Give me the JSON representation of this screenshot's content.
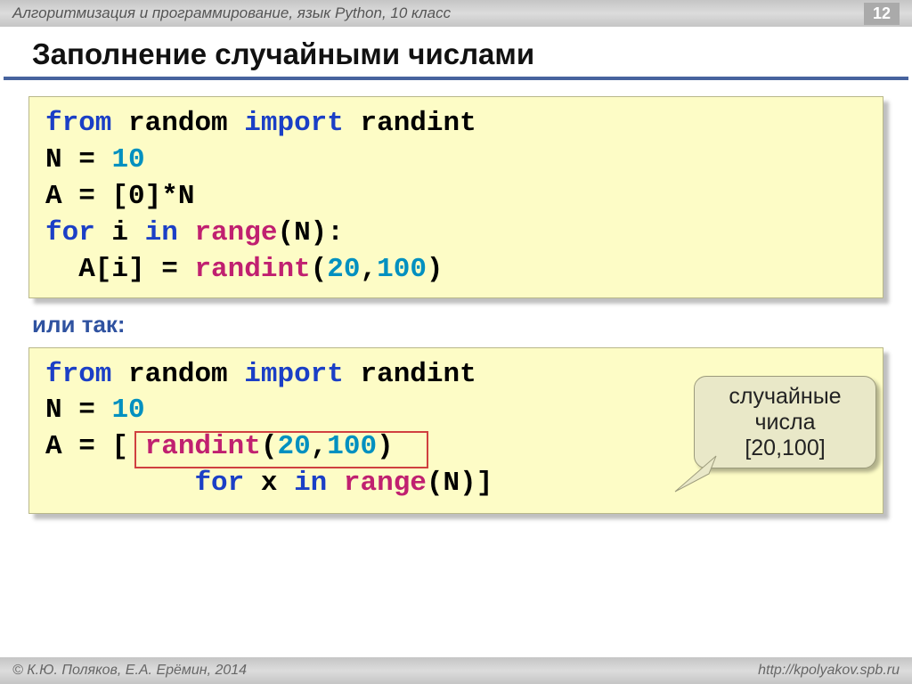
{
  "header": {
    "course": "Алгоритмизация и программирование, язык Python, 10 класс",
    "page": "12"
  },
  "title": "Заполнение случайными числами",
  "code1": {
    "l1": {
      "kw1": "from",
      "mod": "random",
      "kw2": "import",
      "name": "randint"
    },
    "l2": {
      "var": "N",
      "eq": "=",
      "val": "10"
    },
    "l3": {
      "txt": "A = [0]*N"
    },
    "l4": {
      "kw": "for",
      "mid": " i ",
      "kw2": "in",
      "fn": "range",
      "arg": "(N):"
    },
    "l5": {
      "pre": "  A[i] = ",
      "fn": "randint",
      "lp": "(",
      "a1": "20",
      "c": ",",
      "a2": "100",
      "rp": ")"
    }
  },
  "or_label": "или так:",
  "code2": {
    "l1": {
      "kw1": "from",
      "mod": "random",
      "kw2": "import",
      "name": "randint"
    },
    "l2": {
      "var": "N",
      "eq": "=",
      "val": "10"
    },
    "l3": {
      "pre": "A = [ ",
      "fn": "randint",
      "lp": "(",
      "a1": "20",
      "c": ",",
      "a2": "100",
      "rp": ")"
    },
    "l4": {
      "pad": "         ",
      "kw1": "for",
      "mid": " x ",
      "kw2": "in",
      "fn": "range",
      "arg": "(N)]"
    }
  },
  "callout": {
    "line1": "случайные",
    "line2": "числа",
    "line3": "[20,100]"
  },
  "footer": {
    "left": "© К.Ю. Поляков, Е.А. Ерёмин, 2014",
    "right": "http://kpolyakov.spb.ru"
  }
}
